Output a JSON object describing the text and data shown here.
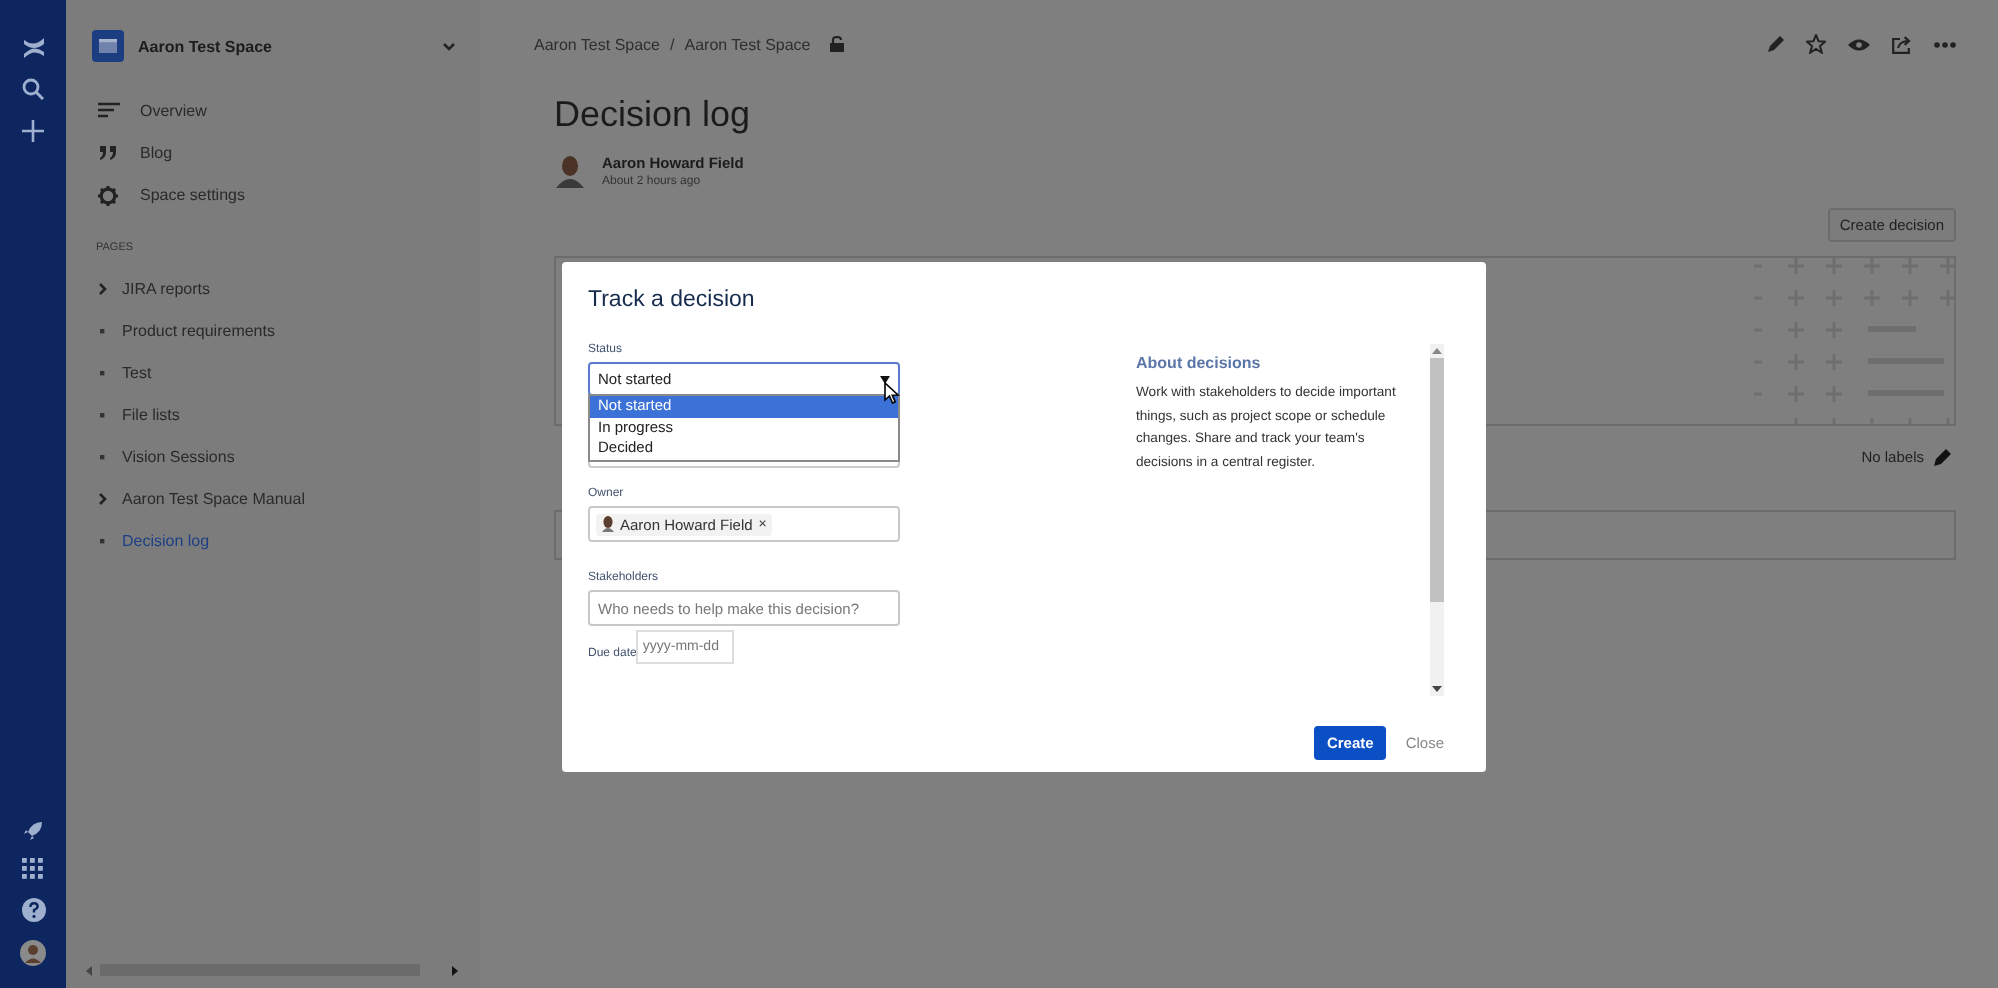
{
  "sidebar": {
    "space_name": "Aaron Test Space",
    "links": [
      {
        "label": "Overview",
        "kind": "overview"
      },
      {
        "label": "Blog",
        "kind": "blog"
      },
      {
        "label": "Space settings",
        "kind": "settings"
      }
    ],
    "pages_heading": "PAGES",
    "pages": [
      {
        "label": "JIRA reports",
        "expandable": true,
        "selected": false
      },
      {
        "label": "Product requirements",
        "expandable": false,
        "selected": false
      },
      {
        "label": "Test",
        "expandable": false,
        "selected": false
      },
      {
        "label": "File lists",
        "expandable": false,
        "selected": false
      },
      {
        "label": "Vision Sessions",
        "expandable": false,
        "selected": false
      },
      {
        "label": "Aaron Test Space Manual",
        "expandable": true,
        "selected": false
      },
      {
        "label": "Decision log",
        "expandable": false,
        "selected": true
      }
    ]
  },
  "breadcrumb": [
    "Aaron Test Space",
    "Aaron Test Space"
  ],
  "breadcrumb_separator": "/",
  "page": {
    "title": "Decision log",
    "author": "Aaron Howard Field",
    "time": "About 2 hours ago",
    "create_button": "Create decision",
    "labels": "No labels"
  },
  "dialog": {
    "title": "Track a decision",
    "status": {
      "label": "Status",
      "value": "Not started",
      "options": [
        {
          "label": "Not started",
          "selected": true
        },
        {
          "label": "In progress",
          "selected": false
        },
        {
          "label": "Decided",
          "selected": false
        }
      ]
    },
    "owner": {
      "label": "Owner",
      "value": "Aaron Howard Field",
      "remove": "×"
    },
    "stakeholders": {
      "label": "Stakeholders",
      "placeholder": "Who needs to help make this decision?"
    },
    "due_date": {
      "label": "Due date",
      "placeholder": "yyyy-mm-dd"
    },
    "about": {
      "heading": "About decisions",
      "text": "Work with stakeholders to decide important things, such as project scope or schedule changes. Share and track your team's decisions in a central register."
    },
    "buttons": [
      {
        "label": "Create",
        "kind": "primary"
      },
      {
        "label": "Close",
        "kind": "link"
      }
    ]
  }
}
